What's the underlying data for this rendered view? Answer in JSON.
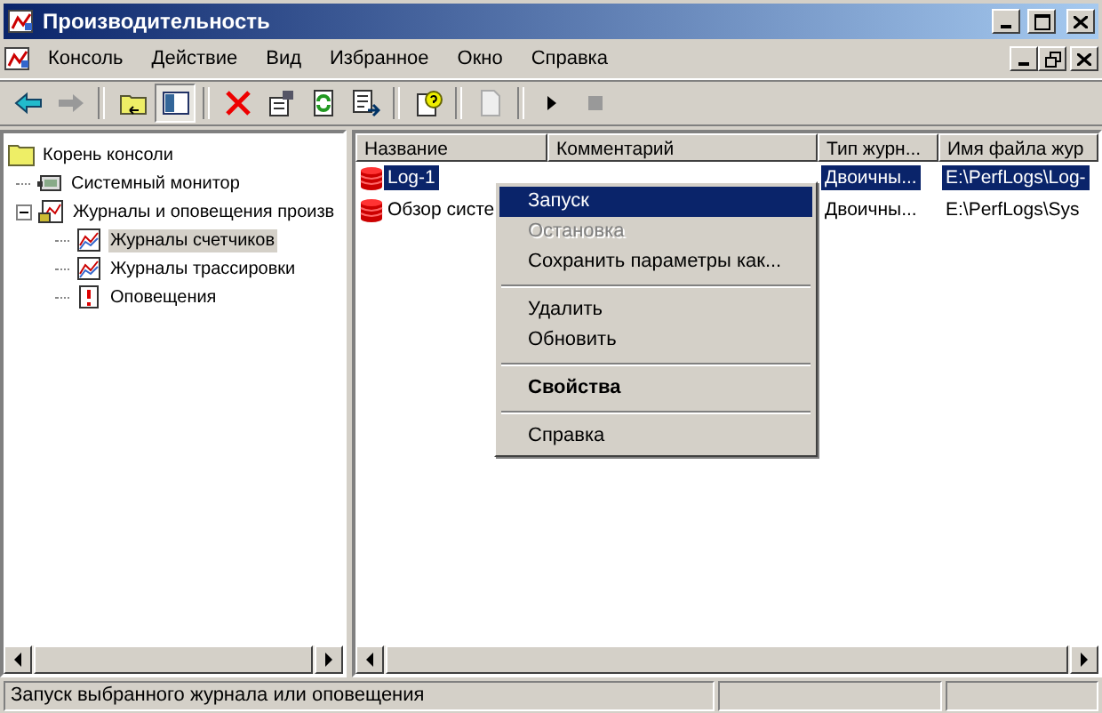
{
  "window": {
    "title": "Производительность"
  },
  "menu": [
    "Консоль",
    "Действие",
    "Вид",
    "Избранное",
    "Окно",
    "Справка"
  ],
  "toolbar": [
    {
      "kind": "back",
      "disabled": false
    },
    {
      "kind": "forward",
      "disabled": true
    },
    {
      "kind": "sep"
    },
    {
      "kind": "up",
      "disabled": false
    },
    {
      "kind": "tree",
      "disabled": false,
      "pressed": true
    },
    {
      "kind": "sep"
    },
    {
      "kind": "delete",
      "disabled": false
    },
    {
      "kind": "properties",
      "disabled": false
    },
    {
      "kind": "refresh",
      "disabled": false
    },
    {
      "kind": "export",
      "disabled": false
    },
    {
      "kind": "sep"
    },
    {
      "kind": "help",
      "disabled": false
    },
    {
      "kind": "sep"
    },
    {
      "kind": "new",
      "disabled": true
    },
    {
      "kind": "sep"
    },
    {
      "kind": "start",
      "disabled": false
    },
    {
      "kind": "stop",
      "disabled": true
    }
  ],
  "tree": [
    {
      "label": "Корень консоли",
      "kind": "folder",
      "selected": false,
      "children": [
        {
          "label": "Системный монитор",
          "kind": "monitor",
          "selected": false
        },
        {
          "label": "Журналы и оповещения произв",
          "kind": "logs",
          "selected": false,
          "expanded": true,
          "children": [
            {
              "label": "Журналы счетчиков",
              "kind": "chart",
              "selected": true
            },
            {
              "label": "Журналы трассировки",
              "kind": "chart",
              "selected": false
            },
            {
              "label": "Оповещения",
              "kind": "alert",
              "selected": false
            }
          ]
        }
      ]
    }
  ],
  "table": {
    "columns": [
      "Название",
      "Комментарий",
      "Тип журн...",
      "Имя файла жур"
    ],
    "rows": [
      {
        "cells": [
          "Log-1",
          "",
          "Двоичны...",
          "E:\\PerfLogs\\Log-"
        ],
        "selected": true
      },
      {
        "cells": [
          "Обзор систе",
          "",
          "Двоичны...",
          "E:\\PerfLogs\\Sys"
        ],
        "selected": false
      }
    ]
  },
  "context_menu": [
    {
      "kind": "item",
      "label": "Запуск",
      "selected": true,
      "disabled": false,
      "default": false
    },
    {
      "kind": "item",
      "label": "Остановка",
      "selected": false,
      "disabled": true,
      "default": false
    },
    {
      "kind": "item",
      "label": "Сохранить параметры как...",
      "selected": false,
      "disabled": false,
      "default": false
    },
    {
      "kind": "separator"
    },
    {
      "kind": "item",
      "label": "Удалить",
      "selected": false,
      "disabled": false,
      "default": false
    },
    {
      "kind": "item",
      "label": "Обновить",
      "selected": false,
      "disabled": false,
      "default": false
    },
    {
      "kind": "separator"
    },
    {
      "kind": "item",
      "label": "Свойства",
      "selected": false,
      "disabled": false,
      "default": true
    },
    {
      "kind": "separator"
    },
    {
      "kind": "item",
      "label": "Справка",
      "selected": false,
      "disabled": false,
      "default": false
    }
  ],
  "status_bar": "Запуск выбранного журнала или оповещения"
}
